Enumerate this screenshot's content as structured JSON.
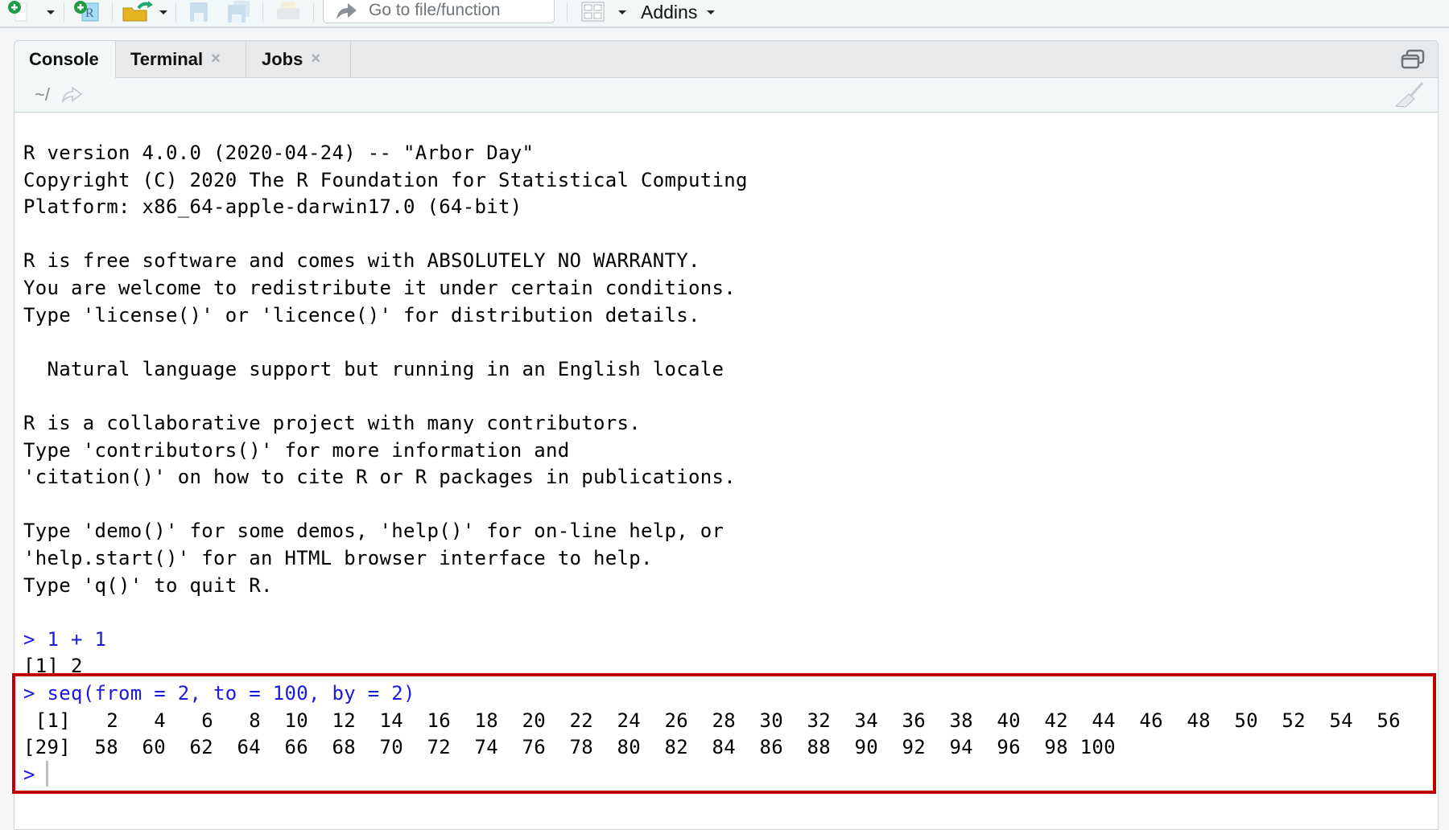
{
  "toolbar": {
    "icons": [
      "new-file-icon",
      "new-project-icon",
      "open-file-icon",
      "save-icon",
      "save-all-icon",
      "print-icon",
      "go-to-arrow-icon",
      "workspace-panes-icon"
    ],
    "goto_placeholder": "Go to file/function",
    "addins_label": "Addins"
  },
  "tabs": [
    {
      "label": "Console",
      "active": true,
      "closable": false
    },
    {
      "label": "Terminal",
      "active": false,
      "closable": true
    },
    {
      "label": "Jobs",
      "active": false,
      "closable": true
    }
  ],
  "tab_close_glyph": "×",
  "path": "~/",
  "console": {
    "banner": [
      "R version 4.0.0 (2020-04-24) -- \"Arbor Day\"",
      "Copyright (C) 2020 The R Foundation for Statistical Computing",
      "Platform: x86_64-apple-darwin17.0 (64-bit)",
      "",
      "R is free software and comes with ABSOLUTELY NO WARRANTY.",
      "You are welcome to redistribute it under certain conditions.",
      "Type 'license()' or 'licence()' for distribution details.",
      "",
      "  Natural language support but running in an English locale",
      "",
      "R is a collaborative project with many contributors.",
      "Type 'contributors()' for more information and",
      "'citation()' on how to cite R or R packages in publications.",
      "",
      "Type 'demo()' for some demos, 'help()' for on-line help, or",
      "'help.start()' for an HTML browser interface to help.",
      "Type 'q()' to quit R."
    ],
    "cmd1": "> 1 + 1",
    "out1": "[1] 2",
    "cmd2": "> seq(from = 2, to = 100, by = 2)",
    "out2_line1": " [1]   2   4   6   8  10  12  14  16  18  20  22  24  26  28  30  32  34  36  38  40  42  44  46  48  50  52  54  56",
    "out2_line2": "[29]  58  60  62  64  66  68  70  72  74  76  78  80  82  84  86  88  90  92  94  96  98 100",
    "prompt": ">"
  },
  "colors": {
    "command": "#1a1adb",
    "highlight_border": "#c00000"
  }
}
